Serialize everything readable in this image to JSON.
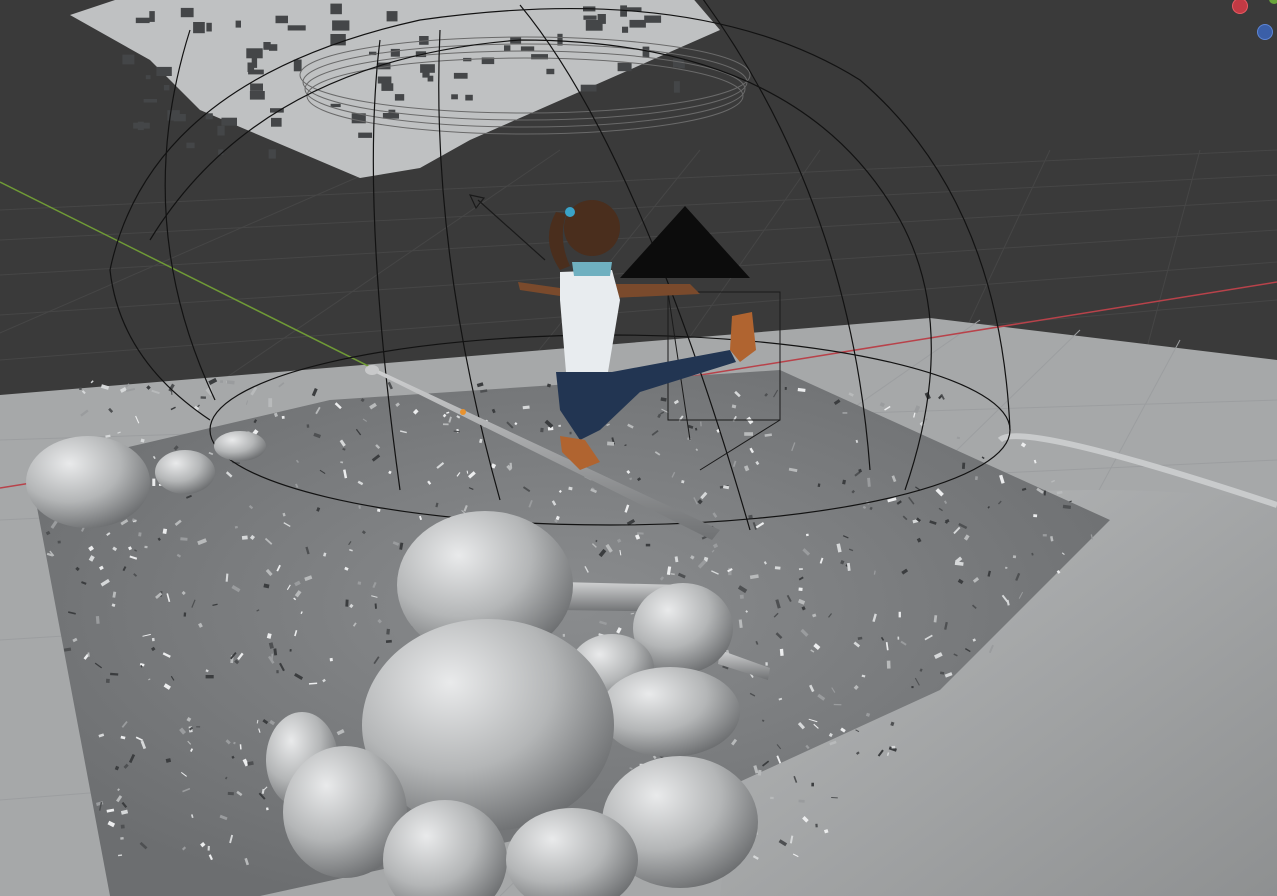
{
  "viewport": {
    "background": "#3a3a3a",
    "grid_color": "#444444",
    "x_axis_color": "#b8424a",
    "y_axis_color": "#6f9a36",
    "ground_color": "#aeb0b1",
    "gizmo": {
      "x_color": "#c23a44",
      "y_color": "#6aa53a",
      "z_color": "#3a5fa8"
    }
  },
  "scene": {
    "character": "cartoon-girl-kicking",
    "objects": [
      "camera",
      "light-cone",
      "empty-cube",
      "dome-wireframe",
      "leaf-litter",
      "logs",
      "boulders",
      "ground-plane"
    ]
  }
}
